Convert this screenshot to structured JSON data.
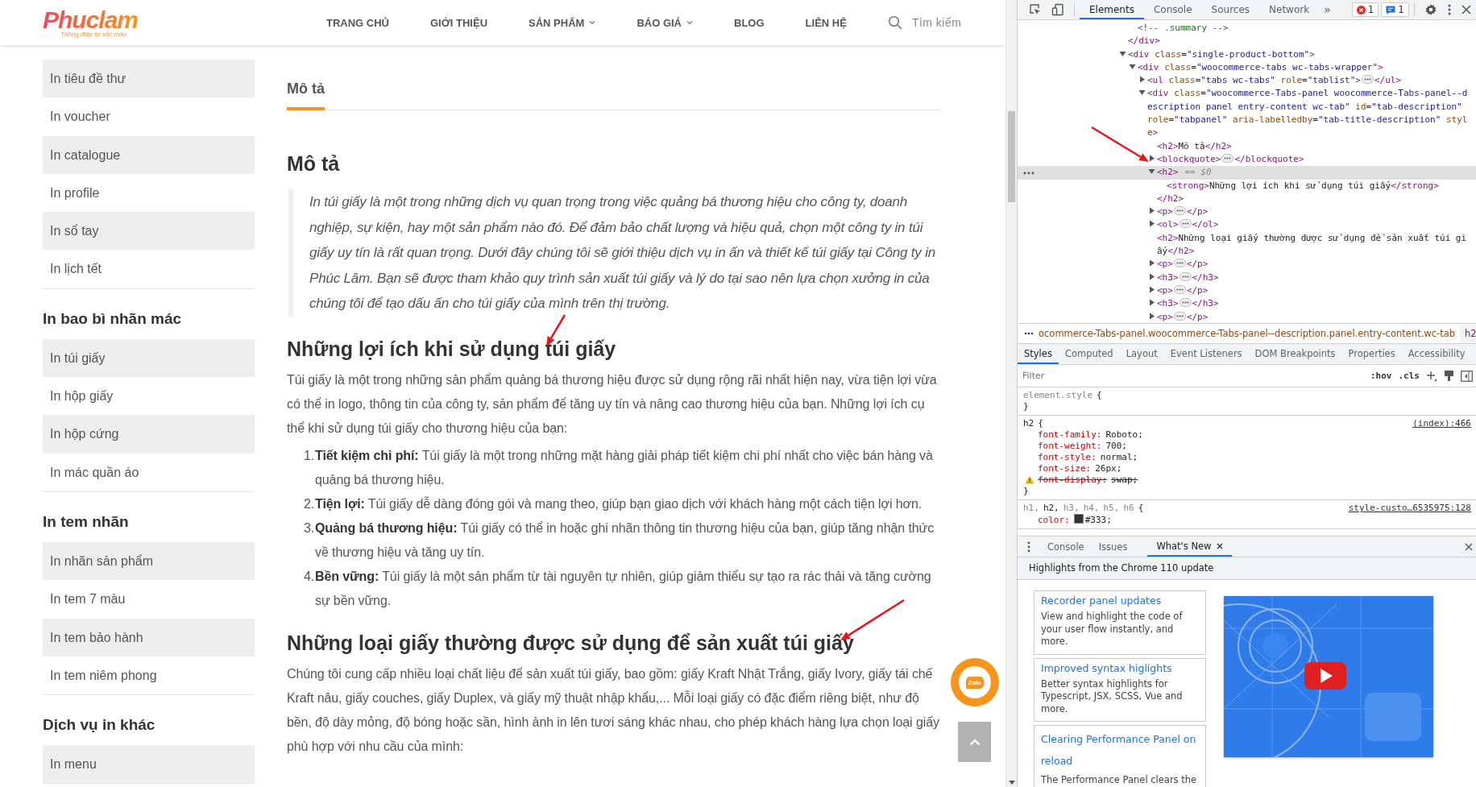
{
  "header": {
    "logo": {
      "name": "Phuclam",
      "tagline": "Thông điệp từ sắc màu"
    },
    "nav": [
      {
        "label": "TRANG CHỦ",
        "has_dropdown": false
      },
      {
        "label": "GIỚI THIỆU",
        "has_dropdown": false
      },
      {
        "label": "SẢN PHẨM",
        "has_dropdown": true
      },
      {
        "label": "BÁO GIÁ",
        "has_dropdown": true
      },
      {
        "label": "BLOG",
        "has_dropdown": false
      },
      {
        "label": "LIÊN HỆ",
        "has_dropdown": false
      }
    ],
    "search": {
      "placeholder": "Tìm kiếm"
    }
  },
  "sidebar": {
    "groups": [
      {
        "items": [
          "In tiêu đề thư",
          "In voucher",
          "In catalogue",
          "In profile",
          "In sổ tay",
          "In lịch tết"
        ]
      },
      {
        "heading": "In bao bì nhãn mác",
        "items": [
          "In túi giấy",
          "In hộp giấy",
          "In hộp cứng",
          "In mác quần áo"
        ]
      },
      {
        "heading": "In tem nhãn",
        "items": [
          "In nhãn sản phẩm",
          "In tem 7 màu",
          "In tem bảo hành",
          "In tem niêm phong"
        ]
      },
      {
        "heading": "Dịch vụ in khác",
        "items": [
          "In menu"
        ]
      }
    ]
  },
  "content": {
    "tabs": [
      {
        "label": "Mô tả",
        "selected": true
      }
    ],
    "title": "Mô tả",
    "intro": "In túi giấy là một trong những dịch vụ quan trọng trong việc quảng bá thương hiệu cho công ty, doanh nghiệp, sự kiện, hay một sản phẩm nào đó. Để đảm bảo chất lượng và hiệu quả, chọn một công ty in túi giấy uy tín là rất quan trọng. Dưới đây chúng tôi sẽ giới thiệu dịch vụ in ấn và thiết kế túi giấy tại Công ty in Phúc Lâm. Bạn sẽ được tham khảo quy trình sản xuất túi giấy và lý do tại sao nên lựa chọn xưởng in của chúng tôi để tạo dấu ấn cho túi giấy của mình trên thị trường.",
    "sections": [
      {
        "heading": "Những lợi ích khi sử dụng túi giấy",
        "paragraph": "Túi giấy là một trong những sản phẩm quảng bá thương hiệu được sử dụng rộng rãi nhất hiện nay, vừa tiện lợi vừa có thể in logo, thông tin của công ty, sản phẩm để tăng uy tín và nâng cao thương hiệu của bạn. Những lợi ích cụ thể khi sử dụng túi giấy cho thương hiệu của bạn:",
        "list": [
          {
            "number": "1.",
            "text": "**Tiết kiệm chi phí:** Túi giấy là một trong những mặt hàng giải pháp tiết kiệm chi phí nhất cho việc bán hàng và quảng bá thương hiệu."
          },
          {
            "number": "2.",
            "text": "**Tiện lợi:** Túi giấy dễ dàng đóng gói và mang theo, giúp bạn giao dịch với khách hàng một cách tiện lợi hơn."
          },
          {
            "number": "3.",
            "text": "**Quảng bá thương hiệu:** Túi giấy có thể in hoặc ghi nhãn thông tin thương hiệu của bạn, giúp tăng nhận thức về thương hiệu và tăng uy tín."
          },
          {
            "number": "4.",
            "text": "**Bền vững:** Túi giấy là một sản phẩm từ tài nguyên tự nhiên, giúp giảm thiểu sự tạo ra rác thải và tăng cường sự bền vững."
          }
        ]
      },
      {
        "heading": "Những loại giấy thường được sử dụng để sản xuất túi giấy",
        "paragraph": "Chúng tôi cung cấp nhiều loại chất liệu để sản xuất túi giấy, bao gồm: giấy Kraft Nhật Trắng, giấy Ivory, giấy tái chế Kraft nâu, giấy couches, giấy Duplex, và giấy mỹ thuật nhập khẩu,... Mỗi loại giấy có đặc điểm riêng biệt, như độ bền, độ dày mỏng, độ bóng hoặc sần, hình ảnh in lên tươi sáng khác nhau, cho phép khách hàng lựa chọn loại giấy phù hợp với nhu cầu của mình:"
      }
    ]
  },
  "chat_button": {
    "label": "Zalo"
  },
  "devtools": {
    "tabs": [
      {
        "label": "Elements",
        "selected": true
      },
      {
        "label": "Console",
        "selected": false
      },
      {
        "label": "Sources",
        "selected": false
      },
      {
        "label": "Network",
        "selected": false
      }
    ],
    "more_tabs": "»",
    "errors": "1",
    "messages": "1",
    "dom_tree": [
      {
        "children": [
          {
            "open": "<!-- .summary -->"
          }
        ],
        "close": "</div>"
      },
      {
        "open": "<div class=\"single-product-bottom\">",
        "expanded": true,
        "children": [
          {
            "open": "<div class=\"woocommerce-tabs wc-tabs-wrapper\">",
            "expanded": true,
            "children": [
              {
                "open": "<ul class=\"tabs wc-tabs\" role=\"tablist\">",
                "close": "</ul>",
                "expanded": false
              },
              {
                "open": "<div class=\"woocommerce-Tabs-panel woocommerce-Tabs-panel--description panel entry-content wc-tab\" id=\"tab-description\" role=\"tabpanel\" aria-labelledby=\"tab-title-description\" style>",
                "expanded": true,
                "children": [
                  {
                    "open": "<h2>Mô tả</h2>"
                  },
                  {
                    "open": "<blockquote>",
                    "close": "</blockquote>",
                    "expanded": false
                  },
                  {
                    "open": "<h2>",
                    "suffix": "== $0",
                    "expanded": true,
                    "selected": true,
                    "children": [
                      {
                        "open": "<strong>Những lợi ích khi sử dụng túi giấy</strong>"
                      }
                    ],
                    "close": "</h2>"
                  },
                  {
                    "open": "<p>",
                    "close": "</p>",
                    "expanded": false
                  },
                  {
                    "open": "<ol>",
                    "close": "</ol>",
                    "expanded": false
                  },
                  {
                    "open": "<h2>Những loại giấy thường được sử dụng để sản xuất túi giấy</h2>"
                  },
                  {
                    "open": "<p>",
                    "close": "</p>",
                    "expanded": false
                  },
                  {
                    "open": "<h3>",
                    "close": "</h3>",
                    "expanded": false
                  },
                  {
                    "open": "<p>",
                    "close": "</p>",
                    "expanded": false
                  },
                  {
                    "open": "<h3>",
                    "close": "</h3>",
                    "expanded": false
                  },
                  {
                    "open": "<p>",
                    "close": "</p>",
                    "expanded": false
                  }
                ]
              }
            ]
          }
        ]
      }
    ],
    "breadcrumb": [
      {
        "label": "ocommerce-Tabs-panel.woocommerce-Tabs-panel--description.panel.entry-content.wc-tab",
        "selected": false
      },
      {
        "label": "h2",
        "selected": true
      }
    ],
    "side_tabs": [
      {
        "label": "Styles",
        "selected": true
      },
      {
        "label": "Computed",
        "selected": false
      },
      {
        "label": "Layout",
        "selected": false
      },
      {
        "label": "Event Listeners",
        "selected": false
      },
      {
        "label": "DOM Breakpoints",
        "selected": false
      },
      {
        "label": "Properties",
        "selected": false
      },
      {
        "label": "Accessibility",
        "selected": false
      }
    ],
    "filter": {
      "placeholder": "Filter",
      "hov": ":hov",
      "cls": ".cls"
    },
    "rules": [
      {
        "selectors": [
          {
            "text": "element.style",
            "matched": false
          }
        ],
        "open": "{",
        "close": "}"
      },
      {
        "selectors": [
          {
            "text": "h2",
            "matched": true
          }
        ],
        "open": "{",
        "source": "(index):466",
        "declarations": [
          {
            "property": "font-family:",
            "value": "Roboto;",
            "overridden": false
          },
          {
            "property": "font-weight:",
            "value": "700;",
            "overridden": false
          },
          {
            "property": "font-style:",
            "value": "normal;",
            "overridden": false
          },
          {
            "property": "font-size:",
            "value": "26px;",
            "overridden": false
          },
          {
            "property": "font-display:",
            "value": "swap;",
            "overridden": true,
            "warning": true
          }
        ],
        "close": "}"
      },
      {
        "selectors": [
          {
            "text": "h1,",
            "matched": false
          },
          {
            "text": "h2,",
            "matched": true
          },
          {
            "text": "h3,",
            "matched": false
          },
          {
            "text": "h4,",
            "matched": false
          },
          {
            "text": "h5,",
            "matched": false
          },
          {
            "text": "h6",
            "matched": false
          }
        ],
        "open": "{",
        "source": "style-custo…6535975:128",
        "declarations": [
          {
            "property": "color:",
            "value": "#333;",
            "kind": "color",
            "overridden": false
          }
        ]
      }
    ],
    "drawer": {
      "tabs": [
        {
          "label": "Console",
          "selected": false
        },
        {
          "label": "Issues",
          "selected": false
        },
        {
          "label": "What's New",
          "selected": true,
          "closable": true
        }
      ],
      "heading": "Highlights from the Chrome 110 update",
      "cards": [
        {
          "title": "Recorder panel updates",
          "text": "View and highlight the code of your user flow instantly, and more."
        },
        {
          "title": "Improved syntax higlights",
          "text": "Better syntax highlights for Typescript, JSX, SCSS, Vue and more."
        },
        {
          "title": "Clearing Performance Panel on reload",
          "text": "The Performance Panel clears the",
          "tall": true
        }
      ]
    }
  }
}
